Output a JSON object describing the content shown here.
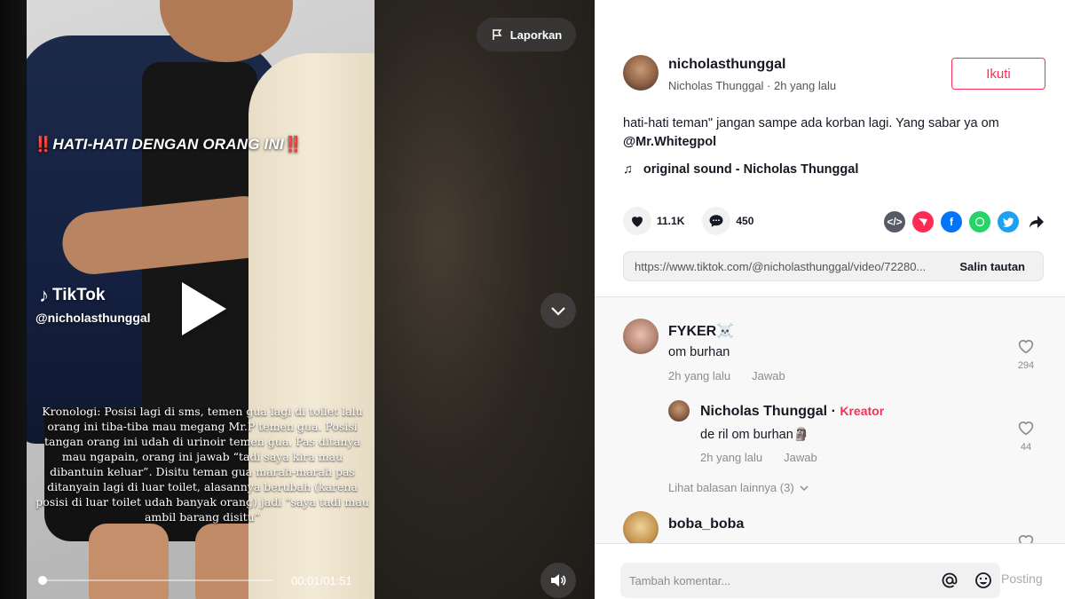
{
  "video": {
    "overlay_title_mark_left": "‼️",
    "overlay_title": "HATI-HATI DENGAN ORANG INI",
    "overlay_title_mark_right": "‼️",
    "watermark_brand": "TikTok",
    "watermark_handle": "@nicholasthunggal",
    "caption": "Kronologi: Posisi lagi di sms, temen gua lagi di toilet lalu orang ini tiba-tiba mau megang Mr.P temen gua. Posisi tangan orang ini udah di urinoir temen gua. Pas ditanya mau ngapain, orang ini jawab “tadi saya kira mau dibantuin keluar”. Disitu teman gua marah-marah pas ditanyain lagi di luar toilet, alasannya berubah (karena posisi di luar toilet udah banyak orang) jadi “saya tadi mau ambil barang disitu”",
    "time": "00:01/01:51",
    "progress_fraction": 0.009,
    "report_label": "Laporkan"
  },
  "author": {
    "handle": "nicholasthunggal",
    "subline": "Nicholas Thunggal · 2h yang lalu",
    "follow_label": "Ikuti"
  },
  "post": {
    "description": "hati-hati teman\" jangan sampe ada korban lagi. Yang sabar ya om",
    "mention": "@Mr.Whitegpol",
    "sound": "original sound - Nicholas Thunggal"
  },
  "stats": {
    "likes": "11.1K",
    "comments": "450"
  },
  "share": {
    "icons": [
      "embed-icon",
      "send-icon",
      "facebook-icon",
      "whatsapp-icon",
      "twitter-icon",
      "forward-icon"
    ],
    "colors": {
      "embed": "#555a64",
      "send": "#fe2c55",
      "facebook": "#0075fa",
      "whatsapp": "#25d366",
      "twitter": "#1da1f2"
    }
  },
  "link": {
    "url": "https://www.tiktok.com/@nicholasthunggal/video/72280...",
    "copy_label": "Salin tautan"
  },
  "comments": [
    {
      "name": "FYKER☠️",
      "text": "om burhan",
      "time": "2h yang lalu",
      "reply_label": "Jawab",
      "likes": "294"
    }
  ],
  "reply": {
    "name": "Nicholas Thunggal",
    "separator": " · ",
    "tag": "Kreator",
    "text": "de ril om burhan🗿",
    "time": "2h yang lalu",
    "reply_label": "Jawab",
    "likes": "44"
  },
  "more_replies": "Lihat balasan lainnya (3)",
  "comment2": {
    "name": "boba_boba"
  },
  "composer": {
    "placeholder": "Tambah komentar...",
    "post_label": "Posting"
  },
  "colors": {
    "accent": "#fe2c55"
  }
}
